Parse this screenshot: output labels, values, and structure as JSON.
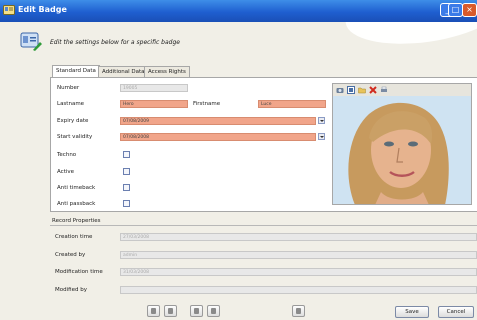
{
  "window": {
    "title": "Edit Badge"
  },
  "header": {
    "text": "Edit the settings below for a specific badge"
  },
  "tabs": [
    {
      "label": "Standard Data"
    },
    {
      "label": "Additional Data"
    },
    {
      "label": "Access Rights"
    }
  ],
  "form": {
    "number_label": "Number",
    "number_value": "19005",
    "lastname_label": "Lastname",
    "lastname_value": "Hero",
    "firstname_label": "Firstname",
    "firstname_value": "Luce",
    "expiry_label": "Expiry date",
    "expiry_value": "07/08/2009",
    "start_label": "Start validity",
    "start_value": "07/08/2008",
    "techno_label": "Techno",
    "active_label": "Active",
    "antitimeback_label": "Anti timeback",
    "antipassback_label": "Anti passback"
  },
  "record": {
    "title": "Record Properties",
    "creation_label": "Creation time",
    "creation_value": "27/03/2008",
    "createdby_label": "Created by",
    "createdby_value": "admin",
    "modification_label": "Modification time",
    "modification_value": "31/03/2008",
    "modifiedby_label": "Modified by",
    "modifiedby_value": ""
  },
  "buttons": {
    "save": "Save",
    "cancel": "Cancel"
  },
  "colors": {
    "title_bar": "#1f5fd0",
    "highlight_field": "#f1a58a",
    "readonly_field": "#e8e8e8",
    "close_button": "#d95a2b"
  }
}
